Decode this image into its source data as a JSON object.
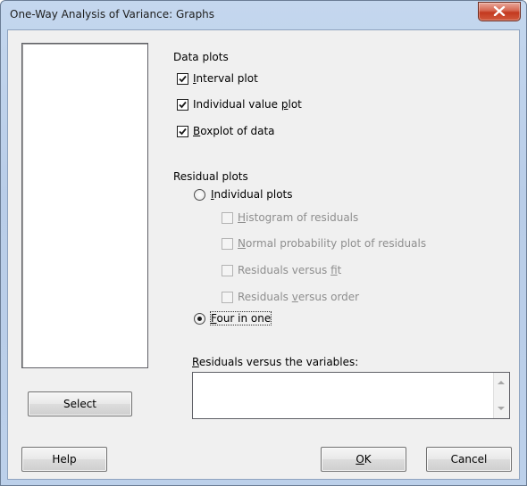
{
  "window": {
    "title": "One-Way Analysis of Variance: Graphs"
  },
  "data_plots": {
    "heading": "Data plots",
    "items": [
      {
        "label": "Interval plot",
        "checked": true
      },
      {
        "label": "Individual value plot",
        "checked": true
      },
      {
        "label": "Boxplot of data",
        "checked": true
      }
    ]
  },
  "residual_plots": {
    "heading": "Residual plots",
    "individual_plots_label": "Individual plots",
    "individual_items": [
      {
        "label": "Histogram of residuals",
        "checked": false,
        "enabled": false
      },
      {
        "label": "Normal probability plot of residuals",
        "checked": false,
        "enabled": false
      },
      {
        "label": "Residuals versus fit",
        "checked": false,
        "enabled": false
      },
      {
        "label": "Residuals versus order",
        "checked": false,
        "enabled": false
      }
    ],
    "four_in_one_label": "Four in one",
    "selected": "Four in one"
  },
  "residuals_vs_variables": {
    "label": "Residuals versus the variables:",
    "value": ""
  },
  "buttons": {
    "select": "Select",
    "help": "Help",
    "ok": "OK",
    "cancel": "Cancel"
  }
}
